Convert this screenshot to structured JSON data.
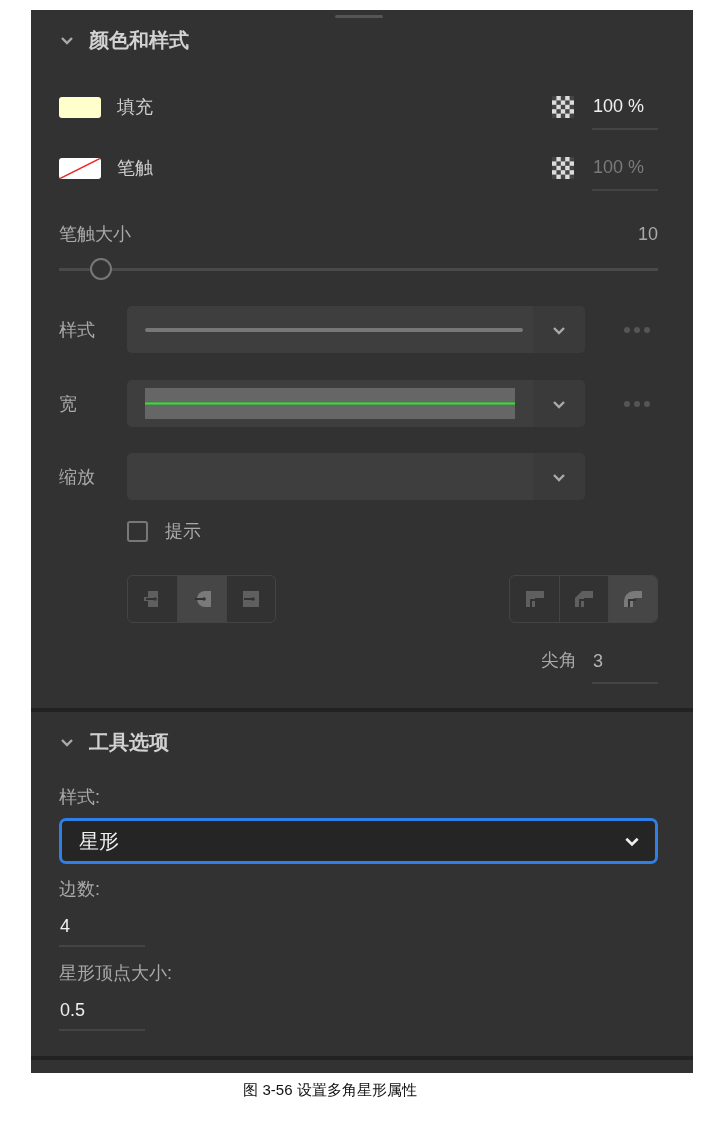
{
  "color_and_style": {
    "title": "颜色和样式",
    "expanded": true,
    "paints": [
      {
        "label": "填充",
        "kind": "solid",
        "color": "#ffffcc",
        "opacity": "100 %",
        "opacity_disabled": false
      },
      {
        "label": "笔触",
        "kind": "none",
        "opacity": "100 %",
        "opacity_disabled": true
      }
    ],
    "stroke_size": {
      "label": "笔触大小",
      "value": "10",
      "level": 0.07
    },
    "dropdowns": [
      {
        "label": "样式",
        "kind": "line",
        "more": true
      },
      {
        "label": "宽",
        "kind": "width",
        "more": true
      },
      {
        "label": "缩放",
        "kind": "empty",
        "more": false
      }
    ],
    "hint": {
      "label": "提示",
      "checked": false
    },
    "caps": [
      {
        "kind": "butt",
        "selected": false
      },
      {
        "kind": "round",
        "selected": true
      },
      {
        "kind": "square",
        "selected": false
      }
    ],
    "joins": [
      {
        "kind": "miter",
        "selected": false
      },
      {
        "kind": "bevel",
        "selected": false
      },
      {
        "kind": "round",
        "selected": true
      }
    ],
    "miter": {
      "label": "尖角",
      "value": "3"
    }
  },
  "tool_options": {
    "title": "工具选项",
    "expanded": true,
    "style": {
      "label": "样式:",
      "value": "星形",
      "focused": true
    },
    "fields": [
      {
        "label": "边数:",
        "value": "4"
      },
      {
        "label": "星形顶点大小:",
        "value": "0.5"
      }
    ]
  },
  "caption": "图 3-56 设置多角星形属性"
}
